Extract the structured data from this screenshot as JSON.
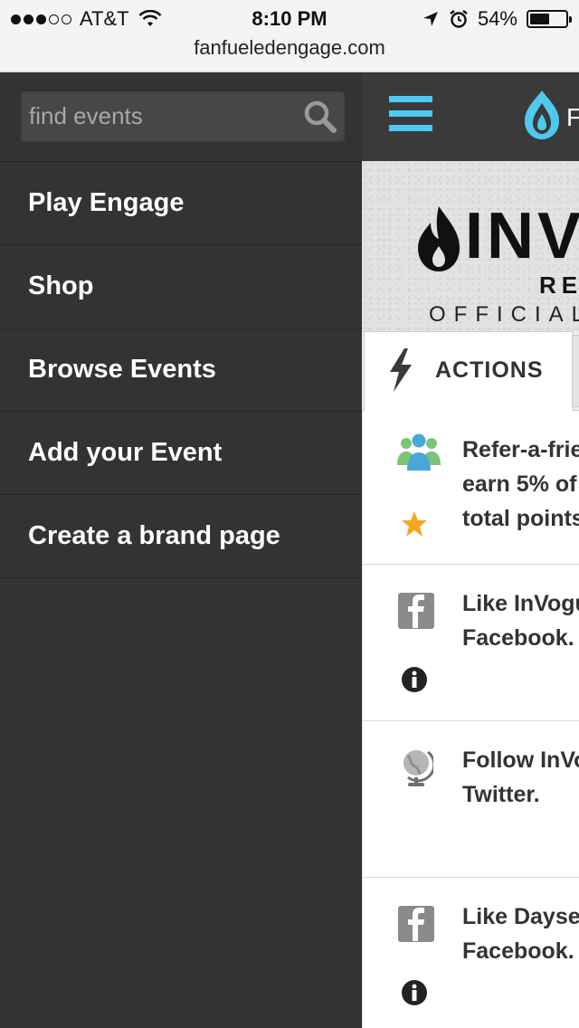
{
  "status_bar": {
    "signal": [
      "full",
      "full",
      "full",
      "empty",
      "empty"
    ],
    "carrier": "AT&T",
    "time": "8:10 PM",
    "battery": "54%",
    "battery_level": 0.54,
    "url": "fanfueledengage.com"
  },
  "side_menu": {
    "search": {
      "placeholder": "find events",
      "icon": "search-icon"
    },
    "items": [
      {
        "label": "Play Engage"
      },
      {
        "label": "Shop"
      },
      {
        "label": "Browse Events"
      },
      {
        "label": "Add your Event"
      },
      {
        "label": "Create a brand page"
      }
    ]
  },
  "header": {
    "menu_icon": "hamburger-icon",
    "logo_icon": "flame-logo-icon",
    "logo_text": "F"
  },
  "banner": {
    "title": "INV",
    "subtitle": "REC",
    "official": "OFFICIAL"
  },
  "tabs": {
    "actions_label": "ACTIONS",
    "actions_icon": "lightning-bolt-icon"
  },
  "actions": [
    {
      "text": "Refer-a-frie\nearn 5% of\ntotal points",
      "icon": "people-icon",
      "sub_icon": "star-icon"
    },
    {
      "text": "Like InVogu\nFacebook.",
      "icon": "facebook-icon",
      "sub_icon": "info-icon"
    },
    {
      "text": "Follow InVo\nTwitter.",
      "icon": "globe-icon",
      "sub_icon": ""
    },
    {
      "text": "Like Dayseo\nFacebook.",
      "icon": "facebook-icon",
      "sub_icon": "info-icon"
    }
  ],
  "colors": {
    "menu_bg": "#333333",
    "accent": "#4ec9f0",
    "star": "#f5a623"
  }
}
